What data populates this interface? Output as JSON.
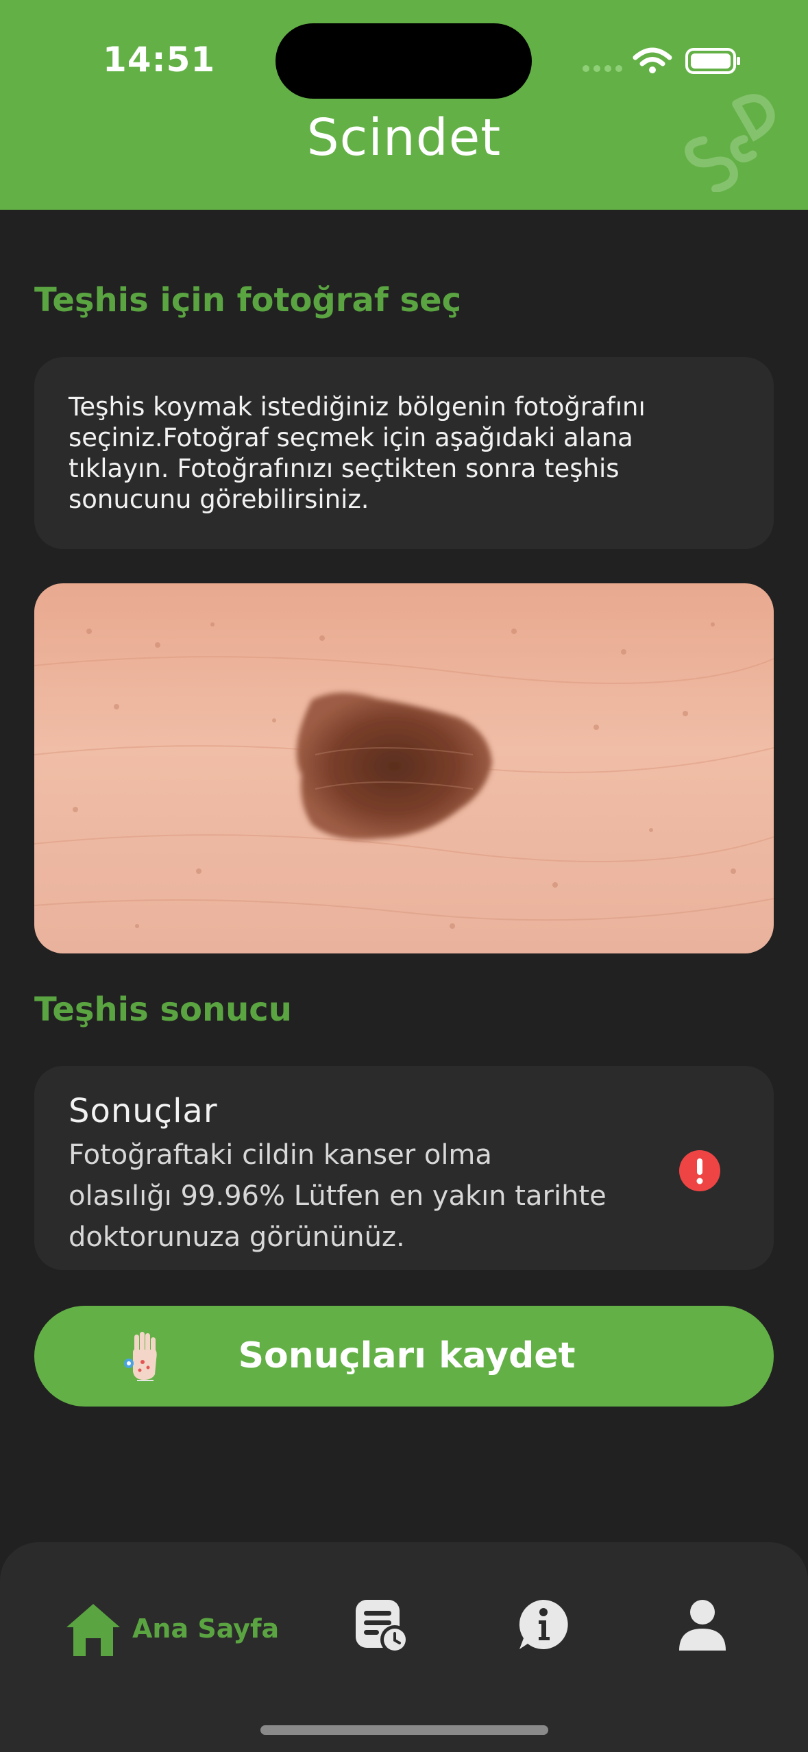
{
  "status_bar": {
    "time": "14:51"
  },
  "header": {
    "title": "Scindet",
    "logo_text": "ScD"
  },
  "select_section": {
    "title": "Teşhis için fotoğraf seç",
    "description_lines": [
      "Teşhis koymak istediğiniz bölgenin fotoğrafını",
      "seçiniz.Fotoğraf seçmek için aşağıdaki alana",
      "tıklayın. Fotoğrafınızı seçtikten sonra teşhis",
      "sonucunu görebilirsiniz."
    ]
  },
  "result_section": {
    "title": "Teşhis sonucu",
    "heading": "Sonuçlar",
    "lines": [
      "Fotoğraftaki cildin kanser olma",
      "olasılığı 99.96% Lütfen en yakın tarihte",
      "doktorunuza görününüz."
    ],
    "alert_icon": "exclamation-circle-icon",
    "alert_color": "#ef4444"
  },
  "save_button": {
    "label": "Sonuçları kaydet",
    "icon": "hand-icon"
  },
  "bottom_nav": {
    "items": [
      {
        "label": "Ana Sayfa",
        "icon": "home-icon",
        "active": true
      },
      {
        "label": "",
        "icon": "history-icon",
        "active": false
      },
      {
        "label": "",
        "icon": "info-icon",
        "active": false
      },
      {
        "label": "",
        "icon": "profile-icon",
        "active": false
      }
    ]
  },
  "colors": {
    "accent": "#63b146",
    "accent_text": "#5aa541",
    "background": "#212121",
    "card": "#2b2b2b"
  }
}
